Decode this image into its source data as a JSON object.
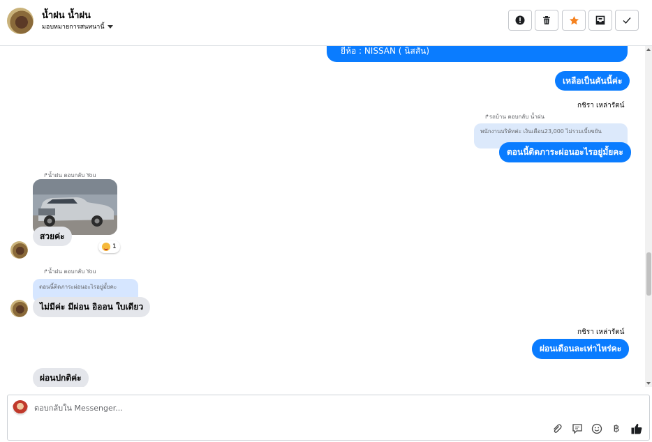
{
  "header": {
    "name": "น้ำฝน น้ำฝน",
    "assign_label": "มอบหมายการสนทนานี้",
    "buttons": {
      "alert": "alert-icon",
      "delete": "trash-icon",
      "star": "star-icon",
      "archive": "archive-icon",
      "done": "check-icon"
    },
    "star_color": "#f5821f"
  },
  "messages": {
    "m1": {
      "text": "ยี่ห้อ : NISSAN ( นิสสัน)"
    },
    "m2": {
      "text": "เหลือเป็นคันนี้ค่ะ"
    },
    "m3": {
      "sender": "กชิรา เหล่ารัตน์",
      "reply_label": "รถบ้าน ตอบกลับ น้ำฝน",
      "quote": "พนักงานบริษัทค่ะ เงินเดือน23,000 ไม่รวมเบี้ยขยัน",
      "text": "ตอนนี้ติดภาระผ่อนอะไรอยู่มั้ยคะ"
    },
    "m4": {
      "reply_label": "น้ำฝน ตอบกลับ You",
      "text": "สวยค่ะ",
      "reaction_count": "1"
    },
    "m5": {
      "reply_label": "น้ำฝน ตอบกลับ You",
      "quote": "ตอนนี้ติดภาระผ่อนอะไรอยู่มั้ยคะ",
      "text": "ไม่มีค่ะ มีผ่อน อิออน ใบเดียว"
    },
    "m6": {
      "sender": "กชิรา เหล่ารัตน์",
      "text": "ผ่อนเดือนละเท่าไหร่คะ"
    },
    "m7": {
      "text": "ผ่อนปกติค่ะ"
    }
  },
  "composer": {
    "placeholder": "ตอบกลับใน Messenger...",
    "tools": [
      "paperclip-icon",
      "note-icon",
      "emoji-icon",
      "baht-icon",
      "thumbs-up-icon"
    ]
  },
  "colors": {
    "outgoing": "#0a7cff",
    "incoming": "#e4e6eb",
    "quote_in": "#d6e6ff",
    "quote_out": "#dce9fb"
  }
}
